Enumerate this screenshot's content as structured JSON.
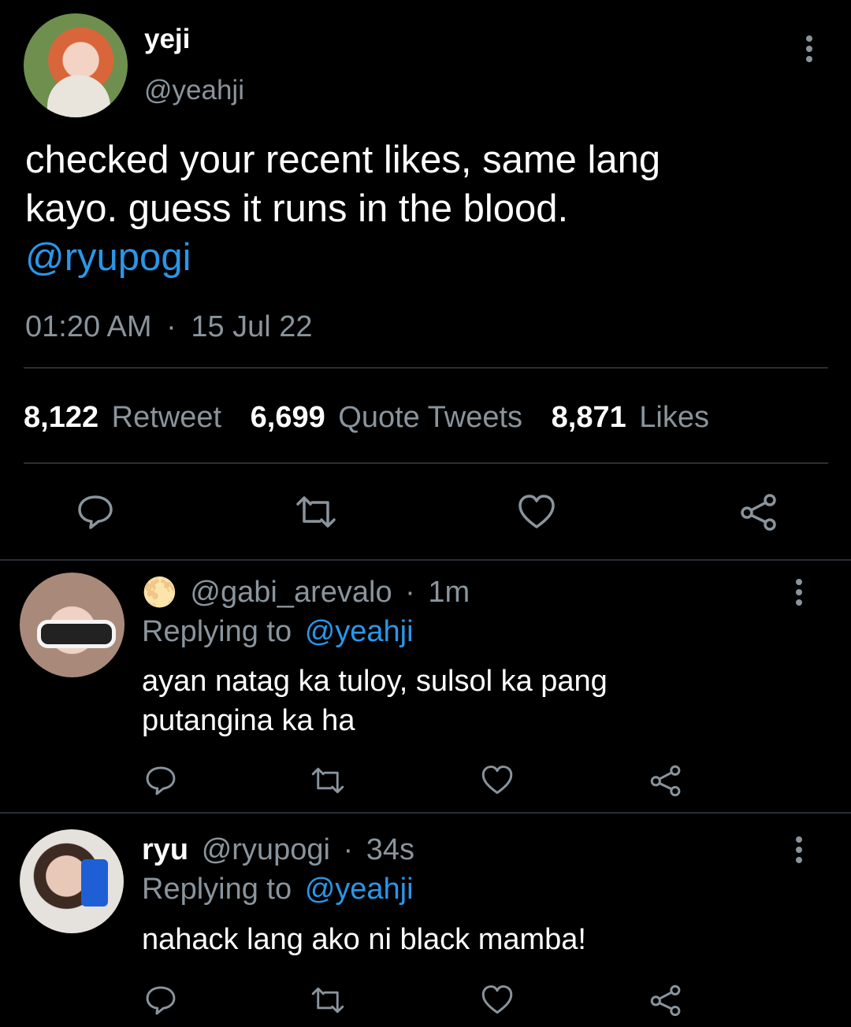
{
  "main_tweet": {
    "display_name": "yeji",
    "handle": "@yeahji",
    "text_line1": "checked your recent likes, same lang",
    "text_line2": "kayo. guess it runs in the blood.",
    "mention": "@ryupogi",
    "time": "01:20 AM",
    "separator": "·",
    "date": "15 Jul 22",
    "stats": {
      "retweet_count": "8,122",
      "retweet_label": "Retweet",
      "quote_count": "6,699",
      "quote_label": "Quote Tweets",
      "likes_count": "8,871",
      "likes_label": "Likes"
    }
  },
  "replies": [
    {
      "emoji": "🌕",
      "handle": "@gabi_arevalo",
      "separator": "·",
      "time": "1m",
      "replying_prefix": "Replying to",
      "replying_to": "@yeahji",
      "text_line1": "ayan natag ka tuloy, sulsol ka pang",
      "text_line2": "putangina ka ha"
    },
    {
      "display_name": "ryu",
      "handle": "@ryupogi",
      "separator": "·",
      "time": "34s",
      "replying_prefix": "Replying to",
      "replying_to": "@yeahji",
      "text_line1": "nahack lang ako ni black mamba!"
    }
  ],
  "icons": {
    "more": "more-vertical-icon",
    "reply": "reply-icon",
    "retweet": "retweet-icon",
    "like": "heart-icon",
    "share": "share-icon"
  },
  "colors": {
    "background": "#000000",
    "text": "#ffffff",
    "muted": "#8a949c",
    "link": "#2a96e8",
    "divider": "#2a2f33"
  }
}
